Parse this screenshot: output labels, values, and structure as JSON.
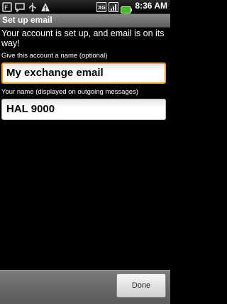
{
  "status_bar": {
    "time": "8:36 AM",
    "icons": [
      "flashcard-notification-icon",
      "chat-icon",
      "usb-icon",
      "warning-icon",
      "3g-signal-icon",
      "signal-bars-icon",
      "battery-icon"
    ],
    "battery_color": "#3fbf1f"
  },
  "title_bar": {
    "title": "Set up email"
  },
  "content": {
    "intro": "Your account is set up, and email is on its way!",
    "account_name": {
      "label": "Give this account a name (optional)",
      "value": "My exchange email"
    },
    "your_name": {
      "label": "Your name (displayed on outgoing messages)",
      "value": "HAL 9000"
    }
  },
  "bottom_bar": {
    "done_label": "Done"
  },
  "colors": {
    "focus": "#ff9a1a",
    "background": "#000000"
  }
}
